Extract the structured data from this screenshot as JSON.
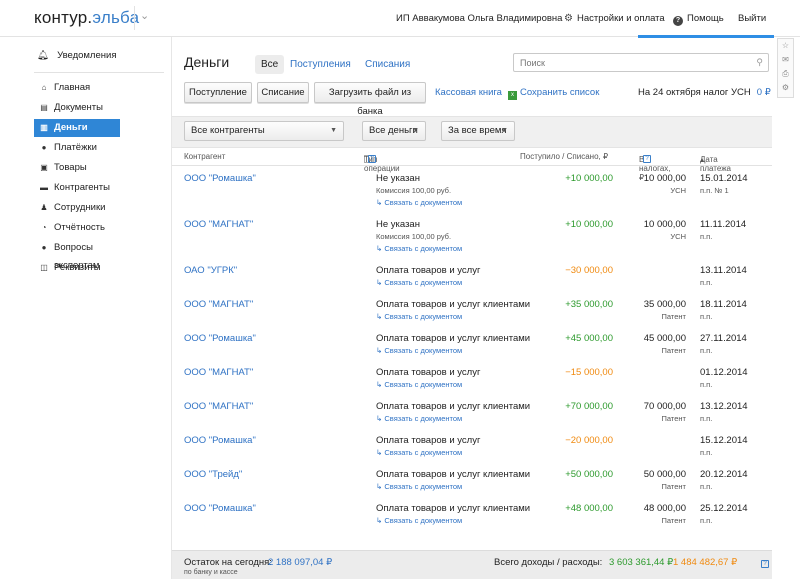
{
  "header": {
    "logo_main": "контур.",
    "logo_accent": "эльба",
    "user": "ИП Аввакумова Ольга Владимировна",
    "settings": "Настройки и оплата",
    "help": "Помощь",
    "exit": "Выйти"
  },
  "sidebar": {
    "notifications": "Уведомления",
    "items": [
      {
        "label": "Главная",
        "icon": "home-icon",
        "glyph": "⌂"
      },
      {
        "label": "Документы",
        "icon": "document-icon",
        "glyph": "▤"
      },
      {
        "label": "Деньги",
        "icon": "money-icon",
        "glyph": "▥"
      },
      {
        "label": "Платёжки",
        "icon": "payment-icon",
        "glyph": "●"
      },
      {
        "label": "Товары",
        "icon": "cart-icon",
        "glyph": "▣"
      },
      {
        "label": "Контрагенты",
        "icon": "briefcase-icon",
        "glyph": "▬"
      },
      {
        "label": "Сотрудники",
        "icon": "person-icon",
        "glyph": "♟"
      },
      {
        "label": "Отчётность",
        "icon": "report-icon",
        "glyph": "◔"
      },
      {
        "label": "Вопросы экспертам",
        "icon": "question-icon",
        "glyph": "●"
      },
      {
        "label": "Реквизиты",
        "icon": "details-icon",
        "glyph": "◫"
      }
    ]
  },
  "main": {
    "title": "Деньги",
    "tabs": [
      "Все",
      "Поступления",
      "Списания"
    ],
    "search_placeholder": "Поиск",
    "buttons": [
      "Поступление",
      "Списание",
      "Загрузить файл из банка"
    ],
    "links": {
      "cashbook": "Кассовая книга",
      "save_list": "Сохранить список"
    },
    "tax_note": "На 24 октября налог УСН",
    "tax_amount": "0 ₽",
    "filters": [
      "Все контрагенты",
      "Все деньги",
      "За все время"
    ],
    "columns": {
      "contractor": "Контрагент",
      "op_type": "Тип операции",
      "amount": "Поступило / Списано, ₽",
      "tax": "В налогах, ₽",
      "date": "Дата платежа"
    },
    "rows": [
      {
        "contractor": "ООО \"Ромашка\"",
        "type": "Не указан",
        "sub": "Комиссия 100,00 руб.",
        "bind": "Связать с документом",
        "amount": "+10 000,00",
        "sign": "pos",
        "tax": "10 000,00",
        "taxsub": "УСН",
        "date": "15.01.2014",
        "pp": "п.п. № 1",
        "tall": true
      },
      {
        "contractor": "ООО \"МАГНАТ\"",
        "type": "Не указан",
        "sub": "Комиссия 100,00 руб.",
        "bind": "Связать с документом",
        "amount": "+10 000,00",
        "sign": "pos",
        "tax": "10 000,00",
        "taxsub": "УСН",
        "date": "11.11.2014",
        "pp": "п.п.",
        "tall": true
      },
      {
        "contractor": "ОАО \"УГРК\"",
        "type": "Оплата товаров и услуг",
        "sub": "",
        "bind": "Связать с документом",
        "amount": "−30 000,00",
        "sign": "neg",
        "tax": "",
        "taxsub": "",
        "date": "13.11.2014",
        "pp": "п.п."
      },
      {
        "contractor": "ООО \"МАГНАТ\"",
        "type": "Оплата товаров и услуг клиентами",
        "sub": "",
        "bind": "Связать с документом",
        "amount": "+35 000,00",
        "sign": "pos",
        "tax": "35 000,00",
        "taxsub": "Патент",
        "date": "18.11.2014",
        "pp": "п.п."
      },
      {
        "contractor": "ООО \"Ромашка\"",
        "type": "Оплата товаров и услуг клиентами",
        "sub": "",
        "bind": "Связать с документом",
        "amount": "+45 000,00",
        "sign": "pos",
        "tax": "45 000,00",
        "taxsub": "Патент",
        "date": "27.11.2014",
        "pp": "п.п."
      },
      {
        "contractor": "ООО \"МАГНАТ\"",
        "type": "Оплата товаров и услуг",
        "sub": "",
        "bind": "Связать с документом",
        "amount": "−15 000,00",
        "sign": "neg",
        "tax": "",
        "taxsub": "",
        "date": "01.12.2014",
        "pp": "п.п."
      },
      {
        "contractor": "ООО \"МАГНАТ\"",
        "type": "Оплата товаров и услуг клиентами",
        "sub": "",
        "bind": "Связать с документом",
        "amount": "+70 000,00",
        "sign": "pos",
        "tax": "70 000,00",
        "taxsub": "Патент",
        "date": "13.12.2014",
        "pp": "п.п."
      },
      {
        "contractor": "ООО \"Ромашка\"",
        "type": "Оплата товаров и услуг",
        "sub": "",
        "bind": "Связать с документом",
        "amount": "−20 000,00",
        "sign": "neg",
        "tax": "",
        "taxsub": "",
        "date": "15.12.2014",
        "pp": "п.п."
      },
      {
        "contractor": "ООО \"Трейд\"",
        "type": "Оплата товаров и услуг клиентами",
        "sub": "",
        "bind": "Связать с документом",
        "amount": "+50 000,00",
        "sign": "pos",
        "tax": "50 000,00",
        "taxsub": "Патент",
        "date": "20.12.2014",
        "pp": "п.п."
      },
      {
        "contractor": "ООО \"Ромашка\"",
        "type": "Оплата товаров и услуг клиентами",
        "sub": "",
        "bind": "Связать с документом",
        "amount": "+48 000,00",
        "sign": "pos",
        "tax": "48 000,00",
        "taxsub": "Патент",
        "date": "25.12.2014",
        "pp": "п.п."
      }
    ],
    "footer": {
      "balance_label": "Остаток на сегодня:",
      "balance_value": "2 188 097,04 ₽",
      "balance_sub": "по банку и кассе",
      "totals_label": "Всего доходы / расходы:",
      "income": "3 603 361,44 ₽",
      "expense": "1 484 482,67 ₽"
    }
  },
  "colors": {
    "accent": "#2f86d6",
    "positive": "#2d9a2d",
    "negative": "#f08a10"
  }
}
